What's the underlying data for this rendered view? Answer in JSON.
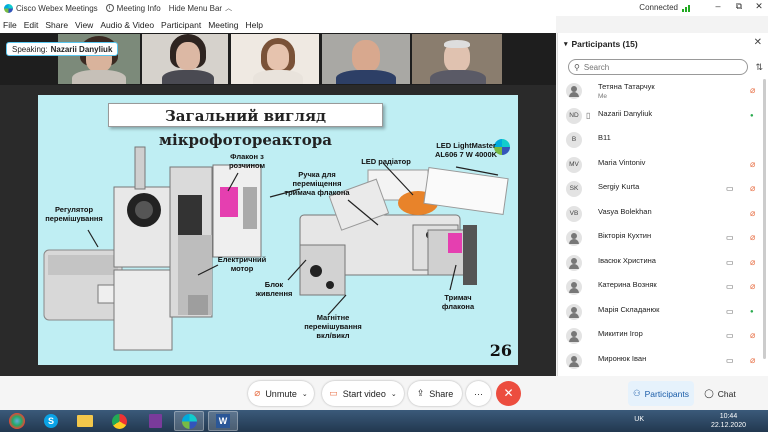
{
  "window": {
    "app_title": "Cisco Webex Meetings",
    "meeting_info": "Meeting Info",
    "hide_menu": "Hide Menu Bar",
    "connection": "Connected"
  },
  "menu": [
    "File",
    "Edit",
    "Share",
    "View",
    "Audio & Video",
    "Participant",
    "Meeting",
    "Help"
  ],
  "speaking": {
    "prefix": "Speaking:",
    "name": "Nazarii Danyliuk"
  },
  "slide": {
    "title": "Загальний вигляд мікрофотореактора",
    "labels": {
      "flask": "Флакон з розчином",
      "handle": "Ручка для переміщення тримача флакона",
      "led_radiator": "LED радіатор",
      "led_model": "LED LightMaster AL606 7 W 4000K",
      "regulator": "Регулятор перемішування",
      "motor": "Електричний мотор",
      "power": "Блок живлення",
      "magnetic": "Магнітне перемішування вкл/викл",
      "holder": "Тримач флакона"
    },
    "number": "26"
  },
  "toolbar": {
    "unmute": "Unmute",
    "start_video": "Start video",
    "share": "Share",
    "more": "···",
    "participants": "Participants",
    "chat": "Chat"
  },
  "panel": {
    "title": "Participants (15)",
    "search_placeholder": "Search",
    "participants": [
      {
        "initials": "",
        "name": "Тетяна Татарчук",
        "sub": "Me",
        "device": "",
        "video": "",
        "mic": "muted"
      },
      {
        "initials": "ND",
        "name": "Nazarii Danyliuk",
        "sub": "",
        "device": "▯",
        "video": "",
        "mic": "active"
      },
      {
        "initials": "B",
        "name": "B11",
        "sub": "",
        "device": "",
        "video": "",
        "mic": "none"
      },
      {
        "initials": "MV",
        "name": "Maria Vintoniv",
        "sub": "",
        "device": "",
        "video": "",
        "mic": "muted"
      },
      {
        "initials": "SK",
        "name": "Sergiy Kurta",
        "sub": "",
        "device": "",
        "video": "cam",
        "mic": "muted"
      },
      {
        "initials": "VB",
        "name": "Vasya Bolekhan",
        "sub": "",
        "device": "",
        "video": "",
        "mic": "muted"
      },
      {
        "initials": "",
        "name": "Вікторія Кухтин",
        "sub": "",
        "device": "",
        "video": "cam",
        "mic": "muted"
      },
      {
        "initials": "",
        "name": "Івасюк Христина",
        "sub": "",
        "device": "",
        "video": "cam",
        "mic": "muted"
      },
      {
        "initials": "",
        "name": "Катерина Возняк",
        "sub": "",
        "device": "",
        "video": "cam",
        "mic": "muted"
      },
      {
        "initials": "",
        "name": "Марія Складанюк",
        "sub": "",
        "device": "",
        "video": "cam",
        "mic": "active"
      },
      {
        "initials": "",
        "name": "Микитин Ігор",
        "sub": "",
        "device": "",
        "video": "cam",
        "mic": "muted"
      },
      {
        "initials": "",
        "name": "Миронюк Іван",
        "sub": "",
        "device": "",
        "video": "cam",
        "mic": "muted"
      }
    ]
  },
  "taskbar": {
    "lang": "UK",
    "time": "10:44",
    "date": "22.12.2020"
  },
  "colors": {
    "accent": "#1a5ca8",
    "end_call": "#ec4d3f",
    "muted": "#e8734a",
    "active_mic": "#2bab4f",
    "slide_bg": "#bfeef3"
  }
}
